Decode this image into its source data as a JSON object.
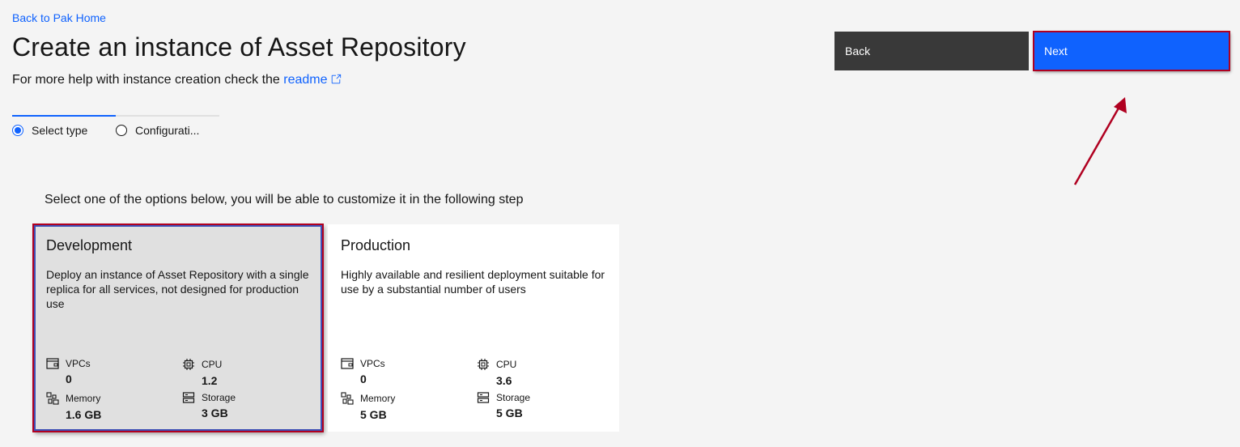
{
  "header": {
    "back_link": "Back to Pak Home",
    "title": "Create an instance of Asset Repository",
    "help_prefix": "For more help with instance creation check the ",
    "help_link": "readme"
  },
  "actions": {
    "back_label": "Back",
    "next_label": "Next"
  },
  "progress": {
    "steps": [
      {
        "label": "Select type",
        "state": "current"
      },
      {
        "label": "Configurati...",
        "state": "incomplete"
      }
    ]
  },
  "main": {
    "instruction": "Select one of the options below, you will be able to customize it in the following step",
    "tiles": [
      {
        "title": "Development",
        "description": "Deploy an instance of Asset Repository with a single replica for all services, not designed for production use",
        "selected": true,
        "specs": {
          "vpcs_label": "VPCs",
          "vpcs_value": "0",
          "cpu_label": "CPU",
          "cpu_value": "1.2",
          "memory_label": "Memory",
          "memory_value": "1.6 GB",
          "storage_label": "Storage",
          "storage_value": "3 GB"
        }
      },
      {
        "title": "Production",
        "description": "Highly available and resilient deployment suitable for use by a substantial number of users",
        "selected": false,
        "specs": {
          "vpcs_label": "VPCs",
          "vpcs_value": "0",
          "cpu_label": "CPU",
          "cpu_value": "3.6",
          "memory_label": "Memory",
          "memory_value": "5 GB",
          "storage_label": "Storage",
          "storage_value": "5 GB"
        }
      }
    ]
  },
  "colors": {
    "accent": "#0f62fe",
    "annotation": "#b00020",
    "back_button": "#393939",
    "selected_tile": "#e0e0e0"
  }
}
